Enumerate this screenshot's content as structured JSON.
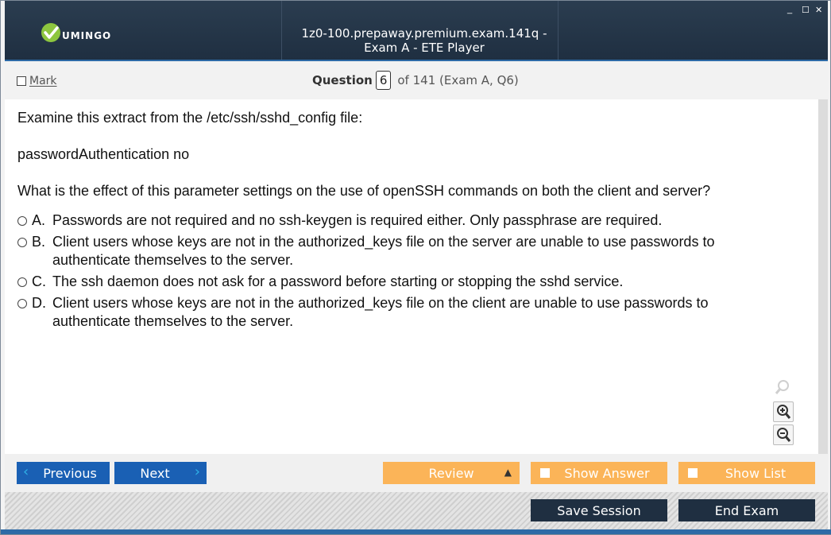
{
  "window": {
    "title": "1z0-100.prepaway.premium.exam.141q - Exam A - ETE Player",
    "logo_text": "UMINGO",
    "controls": [
      "_",
      "☐",
      "✕"
    ]
  },
  "question_bar": {
    "mark_label": "Mark",
    "question_label": "Question",
    "question_number": "6",
    "question_of": "of 141 (Exam A, Q6)"
  },
  "question": {
    "line1": "Examine this extract from the /etc/ssh/sshd_config file:",
    "line2": "passwordAuthentication no",
    "line3": "What is the effect of this parameter settings on the use of openSSH commands on both the client and server?",
    "options": [
      {
        "letter": "A.",
        "text": "Passwords are not required and no ssh-keygen is required either. Only passphrase are required."
      },
      {
        "letter": "B.",
        "text": "Client users whose keys are not in the authorized_keys file on the server are unable to use passwords to authenticate themselves to the server."
      },
      {
        "letter": "C.",
        "text": "The ssh daemon does not ask for a password before starting or stopping the sshd service."
      },
      {
        "letter": "D.",
        "text": "Client users whose keys are not in the authorized_keys file on the client are unable to use passwords to authenticate themselves to the server."
      }
    ]
  },
  "zoom_icons": [
    "magnifier-icon",
    "zoom-in-icon",
    "zoom-out-icon"
  ],
  "nav": {
    "previous": "Previous",
    "next": "Next",
    "review": "Review",
    "show_answer": "Show Answer",
    "show_list": "Show List"
  },
  "footer": {
    "save_session": "Save Session",
    "end_exam": "End Exam"
  },
  "colors": {
    "titlebar": "#1f2f41",
    "nav_blue": "#1a60b4",
    "nav_orange": "#fbb458",
    "footer_dark": "#1f2f41",
    "accent_line": "#2d6aa6"
  }
}
